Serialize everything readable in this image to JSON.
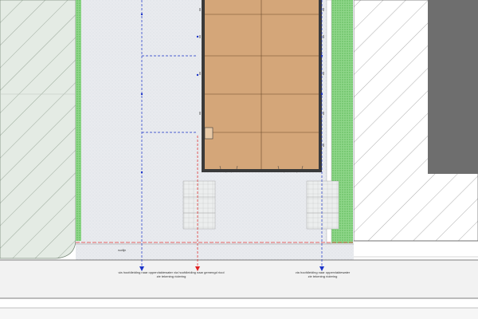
{
  "drawing": {
    "colors": {
      "neighbor_hatch": "#8a9a8a",
      "neighbor_fill": "#e4ebe4",
      "site_fill": "#e9ebef",
      "building_fill": "#d4a679",
      "building_outline": "#3a3a3a",
      "green_strip": "#5fbf5a",
      "paving_fill": "#eceeee",
      "storm_line": "#1a33c9",
      "foul_line": "#e02020",
      "plot_boundary": "#e83a3a",
      "neighbor_building": "#6e6e6e",
      "road_line": "#555555"
    },
    "site_label": "rooilijn",
    "notes": {
      "left_top": "via hoofdleiding naar oppervlaktewater via hoofdleiding naar gemengd riool",
      "left_bottom": "zie tekening riolering",
      "right_top": "via hoofdleiding naar oppervlaktewater",
      "right_bottom": "zie tekening riolering"
    }
  }
}
